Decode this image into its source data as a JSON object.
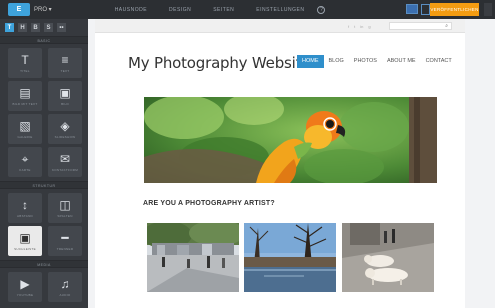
{
  "topbar": {
    "logo": "E",
    "plan": "PRO ▾",
    "nav": [
      "HAUSNODE",
      "DESIGN",
      "SEITEN",
      "EINSTELLUNGEN"
    ],
    "help": "?",
    "publish": "VERÖFFENTLICHEN"
  },
  "sidebar": {
    "tabs": [
      "T",
      "H",
      "B",
      "S",
      "••"
    ],
    "sections": [
      {
        "title": "BASIC",
        "tiles": [
          {
            "icon": "T",
            "label": "TITEL"
          },
          {
            "icon": "≡",
            "label": "TEXT"
          },
          {
            "icon": "▤",
            "label": "BILD MIT TEXT"
          },
          {
            "icon": "▣",
            "label": "BILD"
          },
          {
            "icon": "▧",
            "label": "GALERIE"
          },
          {
            "icon": "◈",
            "label": "SLIDESHOW"
          },
          {
            "icon": "⌖",
            "label": "KARTE"
          },
          {
            "icon": "✉",
            "label": "KONTAKTFORM"
          }
        ]
      },
      {
        "title": "STRUKTUR",
        "tiles": [
          {
            "icon": "↕",
            "label": "ABSTAND"
          },
          {
            "icon": "◫",
            "label": "SPALTEN"
          },
          {
            "icon": "▣",
            "label": "SUCHLEISTE"
          },
          {
            "icon": "━",
            "label": "TRENNER"
          }
        ]
      },
      {
        "title": "MEDIA",
        "tiles": [
          {
            "icon": "▶",
            "label": "YOUTUBE"
          },
          {
            "icon": "♫",
            "label": "AUDIO"
          }
        ]
      }
    ]
  },
  "site": {
    "title": "My Photography Website",
    "nav": [
      "HOME",
      "BLOG",
      "PHOTOS",
      "ABOUT ME",
      "CONTACT"
    ],
    "social": [
      "f",
      "t",
      "in",
      "g"
    ],
    "search_icon": "⌕",
    "headline": "ARE YOU A PHOTOGRAPHY ARTIST?"
  },
  "colors": {
    "accent": "#2f8fcb",
    "publish": "#f39c12",
    "sidebar": "#36393e"
  }
}
